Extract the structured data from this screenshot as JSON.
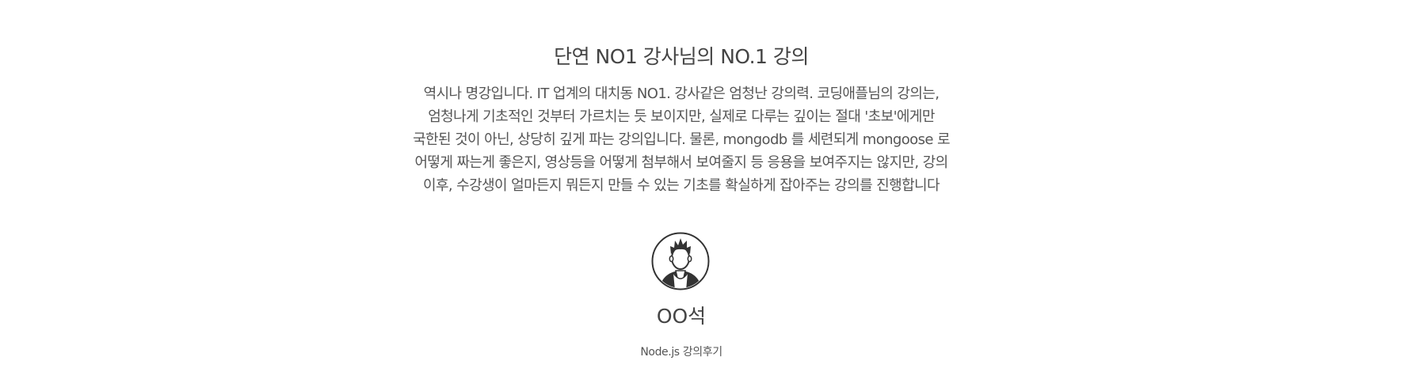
{
  "review": {
    "title": "단연 NO1 강사님의 NO.1 강의",
    "body": "역시나 명강입니다. IT 업계의 대치동 NO1. 강사같은 엄청난 강의력. 코딩애플님의 강의는, 엄청나게 기초적인 것부터 가르치는 듯 보이지만, 실제로 다루는 깊이는 절대 '초보'에게만 국한된 것이 아닌, 상당히 깊게 파는 강의입니다. 물론, mongodb 를 세련되게 mongoose 로 어떻게 짜는게 좋은지, 영상등을 어떻게 첨부해서 보여줄지 등 응용을 보여주지는 않지만, 강의 이후, 수강생이 얼마든지 뭐든지 만들 수 있는 기초를 확실하게 잡아주는 강의를 진행합니다",
    "avatar_icon": "user-avatar-icon",
    "reviewer_name": "OO석",
    "course_label": "Node.js 강의후기"
  }
}
